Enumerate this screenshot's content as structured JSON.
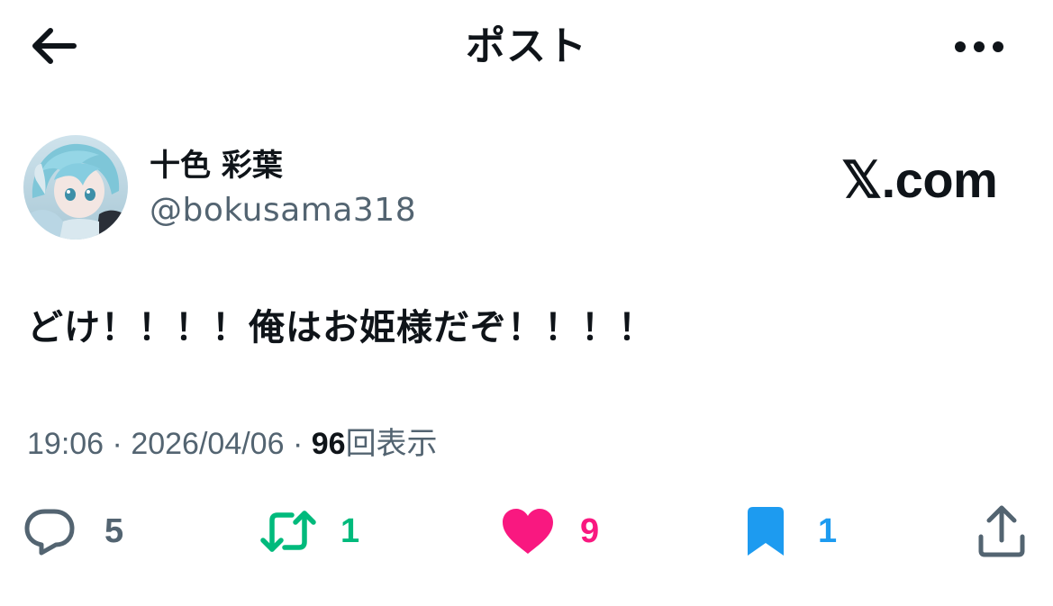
{
  "header": {
    "title": "ポスト",
    "back_icon": "arrow-left-icon",
    "more_icon": "more-horizontal-icon"
  },
  "author": {
    "display_name": "十色 彩葉",
    "handle": "@bokusama318",
    "avatar": "avatar-image"
  },
  "brand": {
    "label": "𝕏.com"
  },
  "post": {
    "text": "どけ！！！！俺はお姫様だぞ！！！！"
  },
  "meta": {
    "time": "19:06",
    "separator": "·",
    "date": "2026/04/06",
    "views_count": "96",
    "views_label": "回表示"
  },
  "actions": {
    "reply": {
      "icon": "reply-icon",
      "count": "5",
      "color": "#536471"
    },
    "repost": {
      "icon": "repost-icon",
      "count": "1",
      "color": "#00ba7c"
    },
    "like": {
      "icon": "heart-icon",
      "count": "9",
      "color": "#f91880"
    },
    "bookmark": {
      "icon": "bookmark-icon",
      "count": "1",
      "color": "#1d9bf0"
    },
    "share": {
      "icon": "share-icon"
    }
  },
  "colors": {
    "text": "#0f1419",
    "secondary": "#536471",
    "background": "#ffffff"
  }
}
